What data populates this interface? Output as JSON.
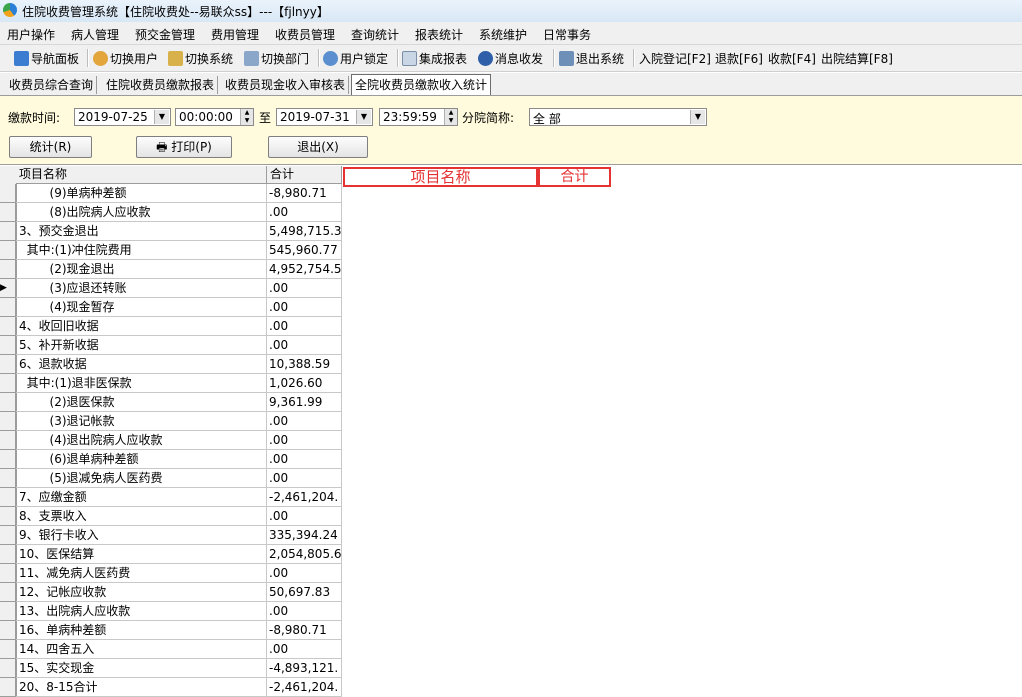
{
  "window": {
    "title": "住院收费管理系统【住院收费处--易联众ss】---【fjlnyy】"
  },
  "menu": [
    "用户操作",
    "病人管理",
    "预交金管理",
    "费用管理",
    "收费员管理",
    "查询统计",
    "报表统计",
    "系统维护",
    "日常事务"
  ],
  "toolbar": {
    "nav_panel": "导航面板",
    "switch_user": "切换用户",
    "switch_system": "切换系统",
    "switch_dept": "切换部门",
    "lock_user": "用户锁定",
    "integrated_report": "集成报表",
    "message": "消息收发",
    "exit": "退出系统",
    "admission": "入院登记[F2]",
    "refund": "退款[F6]",
    "charge": "收款[F4]",
    "discharge": "出院结算[F8]"
  },
  "tabs": [
    "收费员综合查询",
    "住院收费员缴款报表",
    "收费员现金收入审核表",
    "全院收费员缴款收入统计"
  ],
  "filter": {
    "time_label": "缴款时间:",
    "start_date": "2019-07-25",
    "start_time": "00:00:00",
    "to_label": "至",
    "end_date": "2019-07-31",
    "end_time": "23:59:59",
    "branch_label": "分院简称:",
    "branch_value": "全 部",
    "stat_button": "统计(R)",
    "print_button": "打印(P)",
    "exit_button": "退出(X)"
  },
  "grid": {
    "headers": [
      "项目名称",
      "合计"
    ],
    "current_row": 5,
    "rows": [
      [
        "        (9)单病种差额",
        "-8,980.71"
      ],
      [
        "        (8)出院病人应收款",
        ".00"
      ],
      [
        "3、预交金退出",
        "5,498,715.3"
      ],
      [
        "  其中:(1)冲住院费用",
        "545,960.77"
      ],
      [
        "        (2)现金退出",
        "4,952,754.5"
      ],
      [
        "        (3)应退还转账",
        ".00"
      ],
      [
        "        (4)现金暂存",
        ".00"
      ],
      [
        "4、收回旧收据",
        ".00"
      ],
      [
        "5、补开新收据",
        ".00"
      ],
      [
        "6、退款收据",
        "10,388.59"
      ],
      [
        "  其中:(1)退非医保款",
        "1,026.60"
      ],
      [
        "        (2)退医保款",
        "9,361.99"
      ],
      [
        "        (3)退记帐款",
        ".00"
      ],
      [
        "        (4)退出院病人应收款",
        ".00"
      ],
      [
        "        (6)退单病种差额",
        ".00"
      ],
      [
        "        (5)退减免病人医药费",
        ".00"
      ],
      [
        "7、应缴金额",
        "-2,461,204."
      ],
      [
        "8、支票收入",
        ".00"
      ],
      [
        "9、银行卡收入",
        "335,394.24"
      ],
      [
        "10、医保结算",
        "2,054,805.6"
      ],
      [
        "11、减免病人医药费",
        ".00"
      ],
      [
        "12、记帐应收款",
        "50,697.83"
      ],
      [
        "13、出院病人应收款",
        ".00"
      ],
      [
        "16、单病种差额",
        "-8,980.71"
      ],
      [
        "14、四舍五入",
        ".00"
      ],
      [
        "15、实交现金",
        "-4,893,121."
      ],
      [
        "20、8-15合计",
        "-2,461,204."
      ]
    ]
  },
  "pivot": {
    "item_name": "项目名称",
    "total": "合计"
  }
}
